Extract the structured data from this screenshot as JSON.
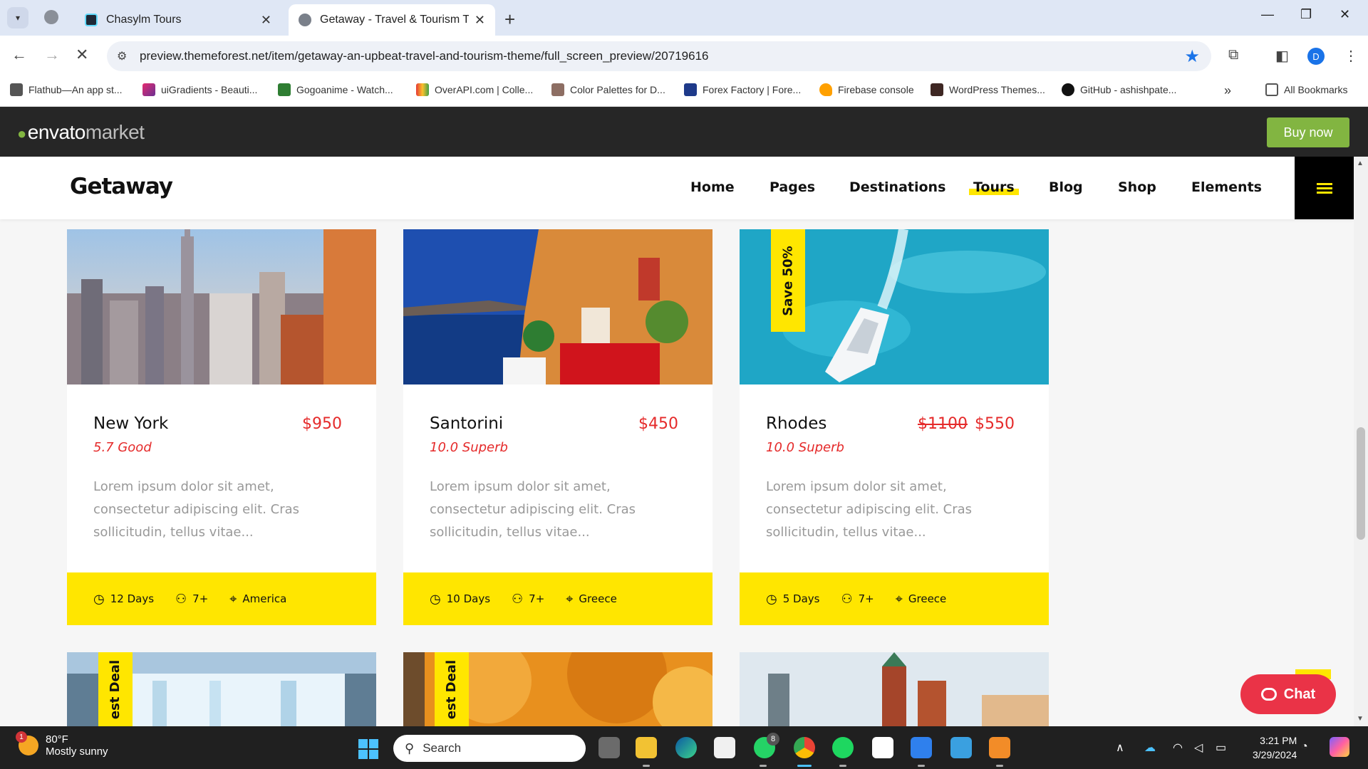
{
  "browser": {
    "tabs": [
      {
        "title": "Chasylm Tours",
        "active": false
      },
      {
        "title": "Getaway - Travel & Tourism The",
        "active": true
      }
    ],
    "new_tab": "+",
    "url": "preview.themeforest.net/item/getaway-an-upbeat-travel-and-tourism-theme/full_screen_preview/20719616",
    "profile_initial": "D",
    "bookmarks": [
      "Flathub—An app st...",
      "uiGradients - Beauti...",
      "Gogoanime - Watch...",
      "OverAPI.com | Colle...",
      "Color Palettes for D...",
      "Forex Factory | Fore...",
      "Firebase console",
      "WordPress Themes...",
      "GitHub - ashishpate..."
    ],
    "all_bookmarks": "All Bookmarks",
    "more": "»"
  },
  "envato": {
    "logo_main": "envato",
    "logo_sub": "market",
    "buy_label": "Buy now",
    "accent": "#82b541"
  },
  "site": {
    "logo": "Getaway",
    "nav": [
      "Home",
      "Pages",
      "Destinations",
      "Tours",
      "Blog",
      "Shop",
      "Elements"
    ],
    "active_nav": "Tours",
    "highlight": "#ffe600",
    "price_color": "#e52a2a"
  },
  "cards": [
    {
      "title": "New York",
      "old_price": "",
      "price": "$950",
      "rating": "5.7 Good",
      "desc": "Lorem ipsum dolor sit amet, consectetur adipiscing elit. Cras sollicitudin, tellus vitae...",
      "days": "12 Days",
      "people": "7+",
      "location": "America",
      "badge": ""
    },
    {
      "title": "Santorini",
      "old_price": "",
      "price": "$450",
      "rating": "10.0 Superb",
      "desc": "Lorem ipsum dolor sit amet, consectetur adipiscing elit. Cras sollicitudin, tellus vitae...",
      "days": "10 Days",
      "people": "7+",
      "location": "Greece",
      "badge": ""
    },
    {
      "title": "Rhodes",
      "old_price": "$1100",
      "price": "$550",
      "rating": "10.0 Superb",
      "desc": "Lorem ipsum dolor sit amet, consectetur adipiscing elit. Cras sollicitudin, tellus vitae...",
      "days": "5 Days",
      "people": "7+",
      "location": "Greece",
      "badge": "Save 50%"
    }
  ],
  "partial_badges": [
    "est Deal",
    "est Deal"
  ],
  "chat_label": "Chat",
  "taskbar": {
    "temp": "80°F",
    "weather": "Mostly sunny",
    "weather_badge": "1",
    "search": "Search",
    "whatsapp_badge": "8",
    "time": "3:21 PM",
    "date": "3/29/2024"
  }
}
